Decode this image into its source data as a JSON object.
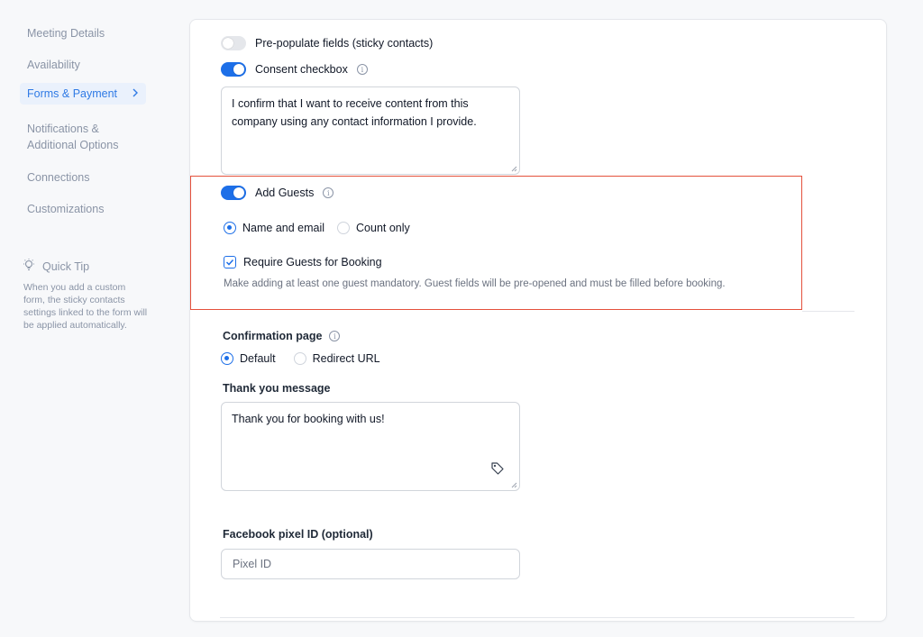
{
  "sidebar": {
    "items": [
      {
        "label": "Meeting Details"
      },
      {
        "label": "Availability"
      },
      {
        "label": "Forms & Payment"
      },
      {
        "label": "Notifications &\nAdditional Options"
      },
      {
        "label": "Connections"
      },
      {
        "label": "Customizations"
      }
    ],
    "active_index": 2,
    "tip": {
      "title": "Quick Tip",
      "text": "When you add a custom form, the sticky contacts settings linked to the form will be applied automatically."
    }
  },
  "form": {
    "prepopulate": {
      "label": "Pre-populate fields (sticky contacts)",
      "enabled": false
    },
    "consent": {
      "label": "Consent checkbox",
      "enabled": true,
      "text": "I confirm that I want to receive content from this company using any contact information I provide."
    },
    "guests": {
      "label": "Add Guests",
      "enabled": true,
      "options": [
        "Name and email",
        "Count only"
      ],
      "selected": "Name and email",
      "require_label": "Require Guests for Booking",
      "require_checked": true,
      "helper": "Make adding at least one guest mandatory. Guest fields will be pre-opened and must be filled before booking."
    },
    "confirmation": {
      "label": "Confirmation page",
      "options": [
        "Default",
        "Redirect URL"
      ],
      "selected": "Default"
    },
    "thank_you": {
      "label": "Thank you message",
      "value": "Thank you for booking with us!"
    },
    "pixel": {
      "label": "Facebook pixel ID (optional)",
      "placeholder": "Pixel ID"
    }
  },
  "colors": {
    "accent": "#1d6fe8",
    "highlight": "#e4513c",
    "muted": "#8a94a6"
  }
}
